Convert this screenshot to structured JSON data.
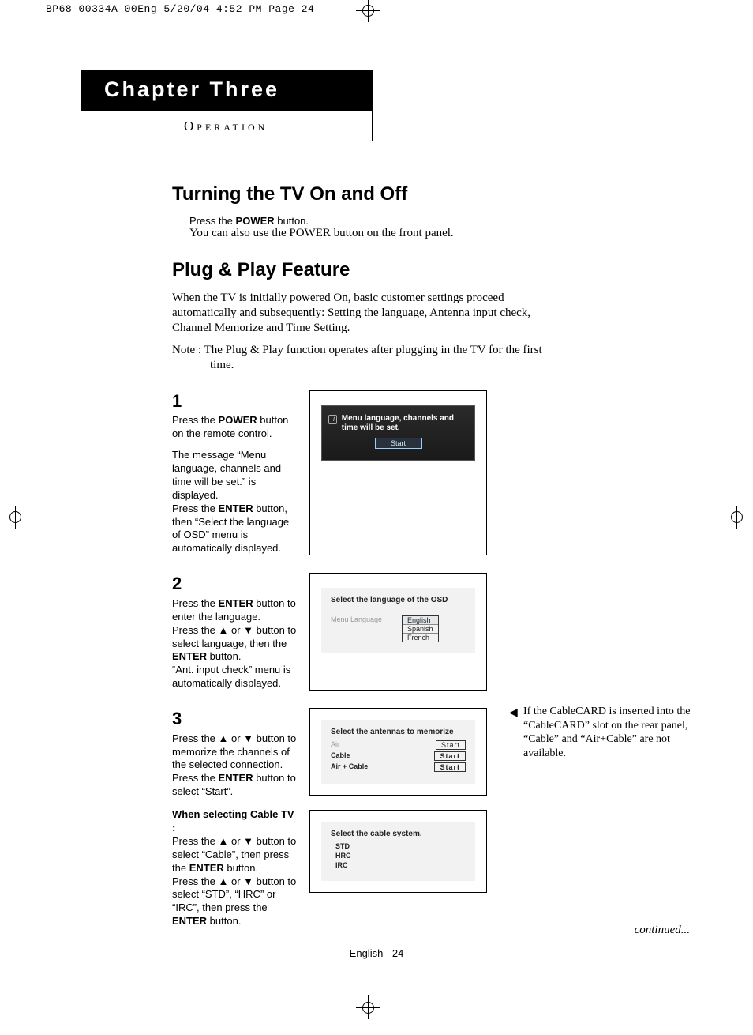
{
  "print_header": "BP68-00334A-00Eng  5/20/04  4:52 PM  Page 24",
  "chapter": {
    "title": "Chapter Three",
    "subtitle": "Operation"
  },
  "section1": {
    "heading": "Turning the TV On and Off",
    "line1_pre": "Press the ",
    "line1_b": "POWER",
    "line1_post": " button.",
    "line2": "You can also use the POWER button on the front panel."
  },
  "section2": {
    "heading": "Plug & Play Feature",
    "para": "When the TV is initially powered On, basic customer settings proceed automatically and subsequently: Setting the language, Antenna input check, Channel Memorize and Time Setting.",
    "note": "Note : The Plug & Play function operates after plugging in the TV for the first time."
  },
  "steps": {
    "s1": {
      "num": "1",
      "t1_pre": "Press the ",
      "t1_b": "POWER",
      "t1_post": " button on the remote control.",
      "t2": "The message “Menu language, channels and time will be set.” is displayed.",
      "t3_pre": "Press the ",
      "t3_b": "ENTER",
      "t3_post": " button, then “Select the language of OSD” menu is automatically displayed.",
      "osd_msg": "Menu language, channels and time will be set.",
      "osd_btn": "Start"
    },
    "s2": {
      "num": "2",
      "t1_pre": "Press the ",
      "t1_b": "ENTER",
      "t1_post": " button to enter the language.",
      "t2": "Press the ▲ or ▼ button to select language, then the ",
      "t2_b": "ENTER",
      "t2_post": " button.",
      "t3": "“Ant. input check” menu is automatically displayed.",
      "osd_title": "Select the language of the OSD",
      "osd_label": "Menu Language",
      "langs": [
        "English",
        "Spanish",
        "French"
      ]
    },
    "s3": {
      "num": "3",
      "t1": "Press the ▲ or ▼ button to memorize the channels of the selected connection. Press the ",
      "t1_b": "ENTER",
      "t1_post": " button to select “Start”.",
      "cable_head": "When selecting Cable TV :",
      "cable_t1": "Press the ▲ or ▼ button to select “Cable”, then press the ",
      "cable_t1_b": "ENTER",
      "cable_t1_post": " button.",
      "cable_t2": "Press the ▲ or ▼ button to select “STD”, “HRC” or “IRC”, then press the ",
      "cable_t2_b": "ENTER",
      "cable_t2_post": " button.",
      "osd_ant_title": "Select the antennas to memorize",
      "ant_rows": [
        {
          "label": "Air",
          "start": "Start",
          "sel": false
        },
        {
          "label": "Cable",
          "start": "Start",
          "sel": true
        },
        {
          "label": "Air + Cable",
          "start": "Start",
          "sel": true
        }
      ],
      "osd_cable_title": "Select the cable system.",
      "cable_items": [
        "STD",
        "HRC",
        "IRC"
      ]
    }
  },
  "sidenote": "If the CableCARD is inserted into the “CableCARD” slot on the rear panel, “Cable” and “Air+Cable” are not available.",
  "footer": "English - 24",
  "continued": "continued..."
}
